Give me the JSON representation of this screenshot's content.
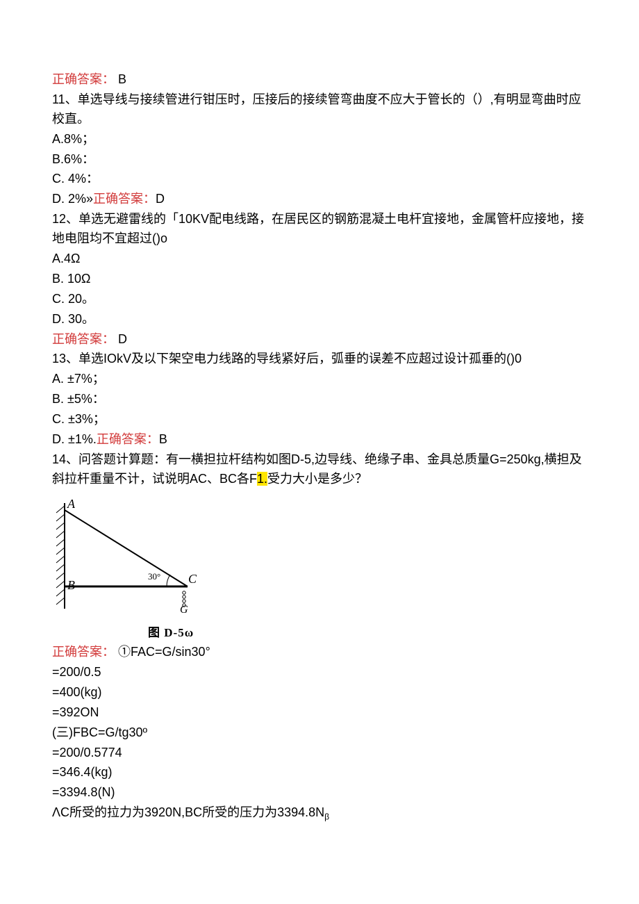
{
  "q10": {
    "answer_label": "正确答案：",
    "answer_value": "B"
  },
  "q11": {
    "header": "11、单选导线与接续管进行钳压时，压接后的接续管弯曲度不应大于管长的（）,有明显弯曲时应校直。",
    "optA": "A.8%；",
    "optB": "B.6%：",
    "optC": "C.  4%：",
    "optD_prefix": "D.  2%»",
    "answer_label": "正确答案：",
    "answer_value": "D"
  },
  "q12": {
    "header": "12、单选无避雷线的「10KV配电线路，在居民区的钢筋混凝土电杆宜接地，金属管杆应接地，接地电阻均不宜超过()o",
    "optA": "A.4Ω",
    "optB": "B.  10Ω",
    "optC": "C.  20。",
    "optD": "D.  30。",
    "answer_label": "正确答案：",
    "answer_value": "D"
  },
  "q13": {
    "header": "13、单选IOkV及以下架空电力线路的导线紧好后，弧垂的误差不应超过设计孤垂的()0",
    "optA": "A.  ±7%；",
    "optB": "B.  ±5%：",
    "optC": "C.  ±3%；",
    "optD_prefix": "D.  ±1%.",
    "answer_label": "正确答案：",
    "answer_value": "B"
  },
  "q14": {
    "header_part1": "14、问答题计算题：有一横担拉杆结构如图D-5,边导线、绝缘子串、金具总质量G=250kg,横担及斜拉杆重量不计，试说明AC、BC各F",
    "header_hl": "1.",
    "header_part2": "受力大小是多少？",
    "fig": {
      "A": "A",
      "B": "B",
      "C": "C",
      "G": "G",
      "angle": "30°",
      "caption": "图 D-5ω"
    },
    "answer_label": "正确答案：",
    "ans_line1": "①FAC=G/sin30°",
    "ans_line2": "=200/0.5",
    "ans_line3": "=400(kg)",
    "ans_line4": "=392ON",
    "ans_line5": "(三)FBC=G/tg30º",
    "ans_line6": "=200/0.5774",
    "ans_line7": "=346.4(kg)",
    "ans_line8": "=3394.8(N)",
    "ans_final_pre": "ΛC所受的拉力为3920N,BC所受的压力为3394.8N",
    "ans_final_sub": "β"
  }
}
